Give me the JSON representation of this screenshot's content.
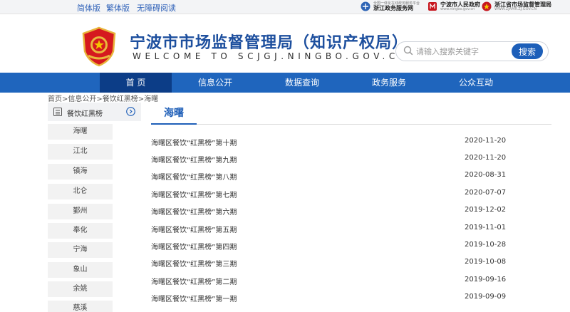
{
  "topbar": {
    "versions": [
      "简体版",
      "繁体版",
      "无障碍阅读"
    ],
    "links": [
      {
        "small": "全国一体化在线政务服务平台",
        "main": "浙江政务服务网",
        "sub": ""
      },
      {
        "small": "",
        "main": "宁波市人民政府",
        "sub": "www.ningbo.gov.cn"
      },
      {
        "small": "",
        "main": "浙江省市场监督管理局",
        "sub": "WWW.ZJAMR.ZJ.GOV.CN"
      }
    ]
  },
  "header": {
    "title": "宁波市市场监督管理局（知识产权局）",
    "subtitle": "WELCOME TO SCJGJ.NINGBO.GOV.CN"
  },
  "search": {
    "placeholder": "请输入搜索关键字",
    "button": "搜索"
  },
  "nav": [
    "首 页",
    "信息公开",
    "数据查询",
    "政务服务",
    "公众互动"
  ],
  "breadcrumb": "首页>信息公开>餐饮红黑榜>海曙",
  "sidebar": {
    "title": "餐饮红黑榜",
    "items": [
      "海曙",
      "江北",
      "镇海",
      "北仑",
      "鄞州",
      "奉化",
      "宁海",
      "象山",
      "余姚",
      "慈溪"
    ]
  },
  "content": {
    "tab": "海曙",
    "rows": [
      {
        "title": "海曙区餐饮“红黑榜”第十期",
        "date": "2020-11-20"
      },
      {
        "title": "海曙区餐饮“红黑榜”第九期",
        "date": "2020-11-20"
      },
      {
        "title": "海曙区餐饮“红黑榜”第八期",
        "date": "2020-08-31"
      },
      {
        "title": "海曙区餐饮“红黑榜”第七期",
        "date": "2020-07-07"
      },
      {
        "title": "海曙区餐饮“红黑榜”第六期",
        "date": "2019-12-02"
      },
      {
        "title": "海曙区餐饮“红黑榜”第五期",
        "date": "2019-11-01"
      },
      {
        "title": "海曙区餐饮“红黑榜”第四期",
        "date": "2019-10-28"
      },
      {
        "title": "海曙区餐饮“红黑榜”第三期",
        "date": "2019-10-08"
      },
      {
        "title": "海曙区餐饮“红黑榜”第二期",
        "date": "2019-09-16"
      },
      {
        "title": "海曙区餐饮“红黑榜”第一期",
        "date": "2019-09-09"
      }
    ]
  },
  "colors": {
    "brand": "#1f65bd",
    "nav_active": "#0c3d87",
    "title": "#1d4f9e"
  },
  "icons": [
    "emblem-logo",
    "search-icon",
    "list-icon",
    "chevron-right-circle-icon"
  ]
}
